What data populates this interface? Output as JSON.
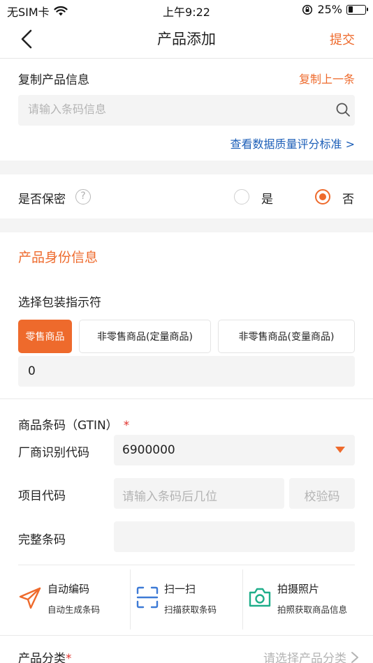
{
  "status_bar": {
    "carrier": "无SIM卡",
    "time": "上午9:22",
    "battery": "25%",
    "battery_level": 0.25
  },
  "nav": {
    "title": "产品添加",
    "submit_label": "提交"
  },
  "copy_section": {
    "title": "复制产品信息",
    "copy_last_label": "复制上一条",
    "search_placeholder": "请输入条码信息",
    "quality_link": "查看数据质量评分标准 >"
  },
  "confidential": {
    "label": "是否保密",
    "help_glyph": "?",
    "option_yes": "是",
    "option_no": "否",
    "selected": "否"
  },
  "identity": {
    "title": "产品身份信息",
    "package_label": "选择包装指示符",
    "package_options": [
      "零售商品",
      "非零售商品(定量商品)",
      "非零售商品(变量商品)"
    ],
    "selected_package": "零售商品",
    "indicator_value": "0"
  },
  "gtin": {
    "title": "商品条码（GTIN）",
    "required_mark": "*",
    "manufacturer_label": "厂商识别代码",
    "manufacturer_value": "6900000",
    "item_label": "项目代码",
    "item_placeholder": "请输入条码后几位",
    "check_digit_placeholder": "校验码",
    "full_label": "完整条码",
    "full_value": ""
  },
  "tools": [
    {
      "title": "自动编码",
      "subtitle": "自动生成条码",
      "icon": "paper-plane-icon"
    },
    {
      "title": "扫一扫",
      "subtitle": "扫描获取条码",
      "icon": "scan-icon"
    },
    {
      "title": "拍摄照片",
      "subtitle": "拍照获取商品信息",
      "icon": "camera-icon"
    }
  ],
  "category": {
    "label": "产品分类",
    "required_mark": "*",
    "placeholder": "请选择产品分类"
  },
  "colors": {
    "accent": "#ee6a2c",
    "link": "#1d5fb8",
    "scan_icon": "#3d7ad6",
    "camera_icon": "#1fae8a"
  }
}
